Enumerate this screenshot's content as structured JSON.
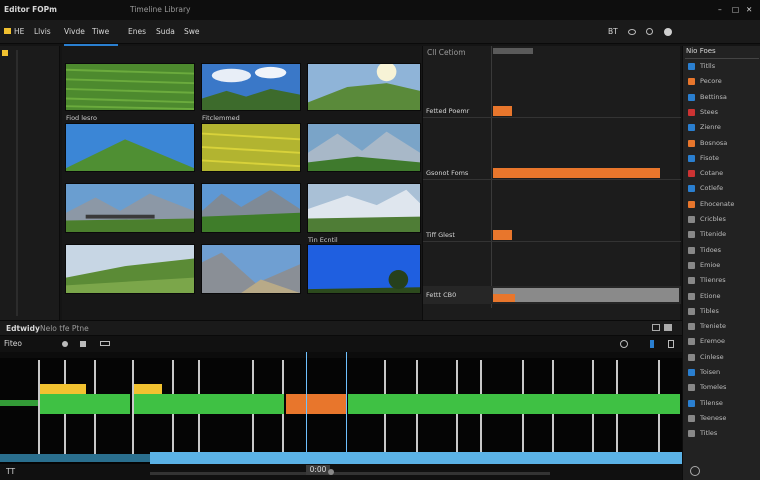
{
  "titlebar": {
    "app_title": "Editor  FOPm",
    "subtitle": "Timeline  Library",
    "window_controls": [
      "–",
      "□",
      "✕"
    ]
  },
  "menu": {
    "items": [
      "HE",
      "Llvis",
      "Vivde",
      "Tiwe",
      "Enes",
      "Suda",
      "Swe"
    ],
    "right_label": "BT",
    "right_icons": [
      "gear-icon",
      "search-icon",
      "settings-icon"
    ]
  },
  "browser": {
    "clips": [
      {
        "label": "Fiod lesro",
        "scene": "field"
      },
      {
        "label": "Fitclemmed",
        "scene": "sky-hills"
      },
      {
        "label": "",
        "scene": "hill-sun"
      },
      {
        "label": "",
        "scene": "green-peak"
      },
      {
        "label": "",
        "scene": "yellow-field"
      },
      {
        "label": "",
        "scene": "alpine-valley"
      },
      {
        "label": "",
        "scene": "bridge-mountains"
      },
      {
        "label": "",
        "scene": "mountain-meadow"
      },
      {
        "label": "",
        "scene": "snow-range"
      },
      {
        "label": "",
        "scene": "rolling-hills"
      },
      {
        "label": "",
        "scene": "rocky-peak"
      },
      {
        "label": "Tin Ecntil",
        "scene": "blue-sky"
      }
    ]
  },
  "inspector": {
    "header": "Cll Cetiom",
    "rows": [
      {
        "label": "Fetted Poemr",
        "fill": 0.1
      },
      {
        "label": "Gsonot Foms",
        "fill": 0.9
      },
      {
        "label": "Tiff Glest",
        "fill": 0.1
      },
      {
        "label": "Fettt CB0",
        "fill": 0.12
      }
    ]
  },
  "properties": {
    "header": "Nio Foes",
    "items": [
      "Titlls",
      "Pecore",
      "Bettinsa",
      "Stees",
      "Zienre",
      "Bosnosa",
      "Fisote",
      "Cotane",
      "Cotlefe",
      "Ehocenate",
      "Cricbles",
      "Titenide",
      "Tidoes",
      "Emioe",
      "Tlienres",
      "Etione",
      "Tibles",
      "Treniete",
      "Eremoe",
      "Cinlese",
      "Toisen",
      "Tomeles",
      "Tilense",
      "Teenese",
      "Titles"
    ]
  },
  "timeline": {
    "header_label": "Edtwidy",
    "header_sub": "Nelo tfe Ptne",
    "toolbar_label": "Fiteo",
    "timecode": "0:00",
    "bottom_label": "TT"
  },
  "colors": {
    "accent_orange": "#e8762c",
    "clip_green": "#3fc144",
    "audio_blue": "#5bb2e6",
    "title_yellow": "#f2c230"
  }
}
